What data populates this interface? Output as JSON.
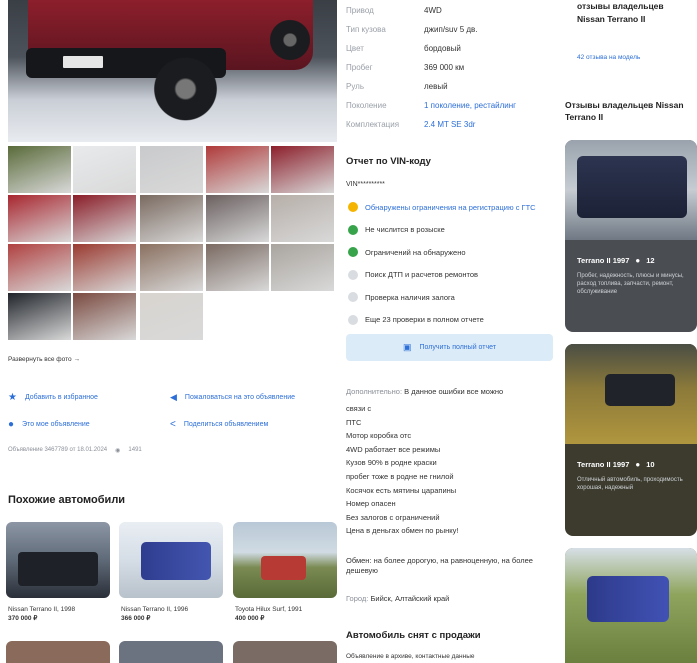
{
  "specs": [
    {
      "k": "Привод",
      "v": "4WD"
    },
    {
      "k": "Тип кузова",
      "v": "джип/suv 5 дв."
    },
    {
      "k": "Цвет",
      "v": "бордовый"
    },
    {
      "k": "Пробег",
      "v": "369 000 км"
    },
    {
      "k": "Руль",
      "v": "левый"
    },
    {
      "k": "Поколение",
      "v": "1 поколение, рестайлинг"
    },
    {
      "k": "Комплектация",
      "v": "2.4 MT SE 3dr"
    }
  ],
  "vin": {
    "title": "Отчет по VIN-коду",
    "code": "VIN**********",
    "items": [
      {
        "status": "warn",
        "text": "Обнаружены ограничения на регистрацию с ГТС"
      },
      {
        "status": "ok",
        "text": "Не числится в розыске"
      },
      {
        "status": "ok",
        "text": "Ограничений на обнаружено"
      },
      {
        "status": "lock",
        "text": "Поиск ДТП и расчетов ремонтов"
      },
      {
        "status": "lock",
        "text": "Проверка наличия залога"
      },
      {
        "status": "lock",
        "text": "Еще 23 проверки в полном отчете"
      }
    ],
    "button": "Получить полный отчет"
  },
  "description": {
    "label": "Дополнительно:",
    "first": "В данное ошибки все можно",
    "lines": [
      "связи с",
      "ПТС",
      "Мотор коробка отс",
      "4WD работает все режимы",
      "Кузов 90% в родне краски",
      "пробег тоже в родне не гнилой",
      "Косячок есть мятины царапины",
      "Номер опасен",
      "Без залогов с ограничений",
      "Цена в деньгах обмен по рынку!"
    ],
    "exchange": "Обмен: на более дорогую, на равноценную, на более дешевую",
    "city_label": "Город:",
    "city": "Бийск, Алтайский край"
  },
  "sold": {
    "title": "Автомобиль снят с продажи",
    "text": "Объявление в архиве, контактные данные"
  },
  "left": {
    "expand": "Развернуть все фото →",
    "actions": [
      {
        "icon": "star-icon",
        "text": "Добавить в избранное"
      },
      {
        "icon": "megaphone-icon",
        "text": "Пожаловаться на это объявление"
      },
      {
        "icon": "user-icon",
        "text": "Это мое объявление"
      },
      {
        "icon": "share-icon",
        "text": "Поделиться объявлением"
      }
    ],
    "meta": "Объявление 3467789 от 18.01.2024",
    "views": "1491",
    "similar_title": "Похожие автомобили",
    "similar": [
      {
        "name": "Nissan Terrano II, 1998",
        "price": "370 000 ₽"
      },
      {
        "name": "Nissan Terrano II, 1996",
        "price": "366 000 ₽"
      },
      {
        "name": "Toyota Hilux Surf, 1991",
        "price": "400 000 ₽"
      }
    ]
  },
  "right": {
    "top_title": "отзывы владельцев Nissan Terrano II",
    "top_link": "42 отзыва на модель",
    "reviews_title": "Отзывы владельцев Nissan Terrano II",
    "reviews": [
      {
        "title": "Terrano II 1997",
        "count": "12",
        "text": "Пробег, надежность, плюсы и минусы, расход топлива, запчасти, ремонт, обслуживание"
      },
      {
        "title": "Terrano II 1997",
        "count": "10",
        "text": "Отличный автомобиль, проходимость хорошая, надежный"
      },
      {
        "title": "",
        "count": "",
        "text": ""
      }
    ]
  }
}
